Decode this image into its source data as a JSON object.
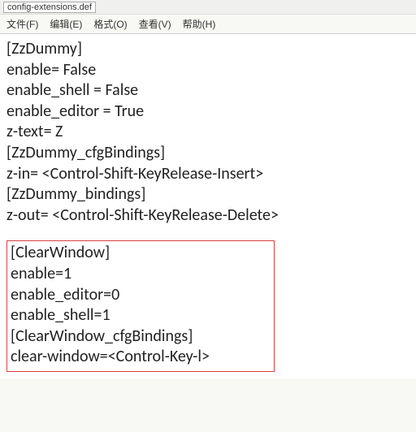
{
  "titlebar": {
    "tab": "config-extensions.def"
  },
  "menu": {
    "file": "文件(F)",
    "edit": "编辑(E)",
    "format": "格式(O)",
    "view": "查看(V)",
    "help": "帮助(H)"
  },
  "block1": {
    "l1": "[ZzDummy]",
    "l2": "enable= False",
    "l3": "enable_shell = False",
    "l4": "enable_editor = True",
    "l5": "z-text= Z",
    "l6": "[ZzDummy_cfgBindings]",
    "l7": "z-in= <Control-Shift-KeyRelease-Insert>",
    "l8": "[ZzDummy_bindings]",
    "l9": "z-out= <Control-Shift-KeyRelease-Delete>"
  },
  "block2": {
    "l1": "[ClearWindow]",
    "l2": "enable=1",
    "l3": "enable_editor=0",
    "l4": "enable_shell=1",
    "l5": "[ClearWindow_cfgBindings]",
    "l6": "clear-window=<Control-Key-l>"
  }
}
